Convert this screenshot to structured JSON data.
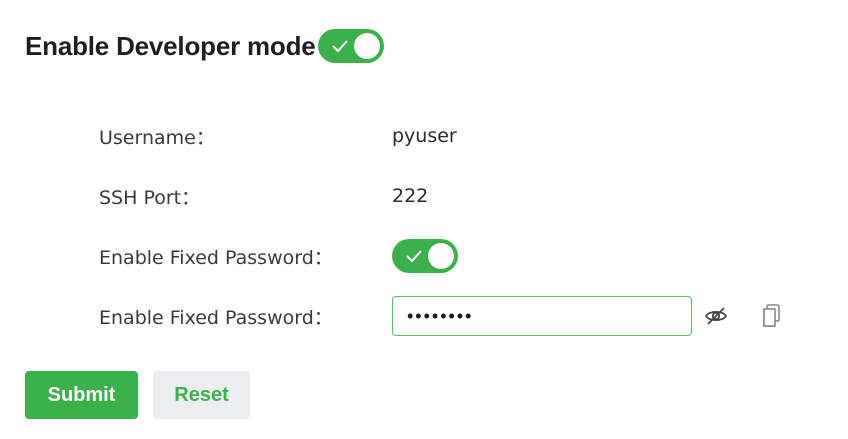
{
  "header": {
    "title": "Enable Developer mode",
    "developer_mode_enabled": true
  },
  "form": {
    "username": {
      "label": "Username：",
      "value": "pyuser"
    },
    "ssh_port": {
      "label": "SSH Port：",
      "value": "222"
    },
    "fixed_password_toggle": {
      "label": "Enable Fixed Password：",
      "enabled": true
    },
    "fixed_password_field": {
      "label": "Enable Fixed Password：",
      "masked_value": "••••••••"
    }
  },
  "icons": {
    "toggle_visibility": "eye-slash-icon",
    "copy": "copy-icon",
    "toggle_check": "check-icon"
  },
  "buttons": {
    "submit_label": "Submit",
    "reset_label": "Reset"
  },
  "colors": {
    "accent": "#3cb04a",
    "input_border": "#5cbf67",
    "reset_bg": "#ebedf0"
  }
}
